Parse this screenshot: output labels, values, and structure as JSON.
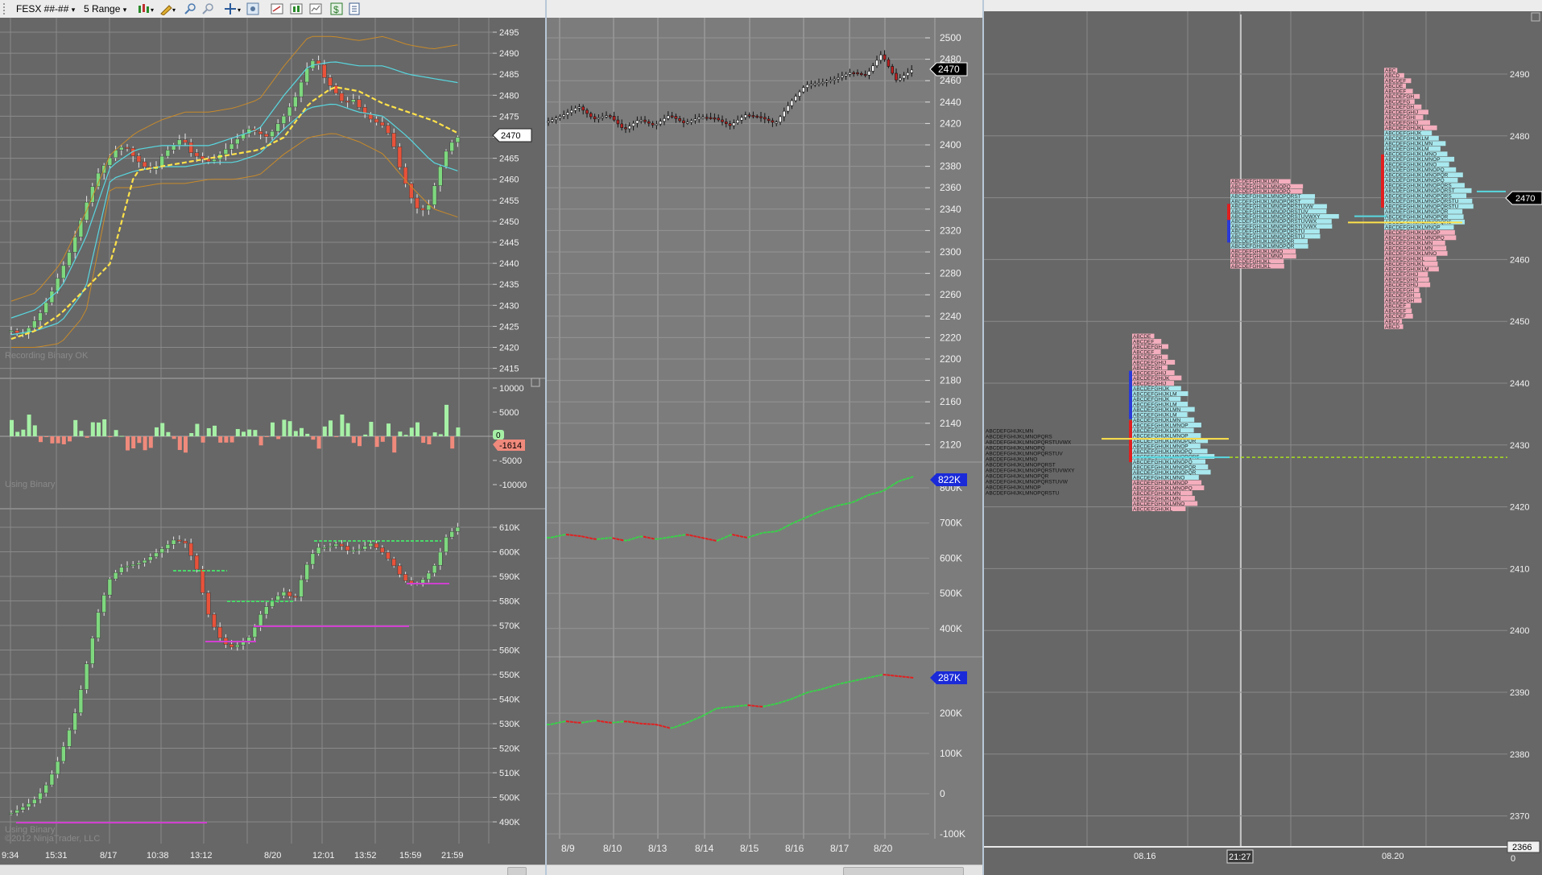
{
  "toolbar": {
    "instrument": "FESX ##-##",
    "bar_type": "5 Range",
    "chevron": "▾"
  },
  "colors": {
    "panel": "#676767",
    "panel_mid": "#7c7c7c",
    "grid": "#8a8a8a",
    "up": "#7ed87e",
    "down": "#e8523a",
    "volup": "#a6f0a6",
    "voldn": "#f08a7c",
    "yellow": "#ffe24a",
    "cyan": "#58d8e0",
    "orange": "#c88a2a",
    "magenta": "#d040d0",
    "tpo_pink": "#f4aebd",
    "tpo_cyan": "#a8e8ee",
    "axis_text": "#f2f2f2"
  },
  "left": {
    "price": {
      "ticks": [
        "2495",
        "2490",
        "2485",
        "2480",
        "2475",
        "2470",
        "2465",
        "2460",
        "2455",
        "2450",
        "2445",
        "2440",
        "2435",
        "2430",
        "2425",
        "2420",
        "2415"
      ],
      "last": "2470",
      "watermark": "Recording Binary OK"
    },
    "delta": {
      "ticks": [
        "10000",
        "5000",
        "0",
        "-5000",
        "-10000"
      ],
      "last": "-1614",
      "zero_tag": "0",
      "watermark": "Using Binary"
    },
    "cum": {
      "ticks": [
        "610K",
        "600K",
        "590K",
        "580K",
        "570K",
        "560K",
        "550K",
        "540K",
        "530K",
        "520K",
        "510K",
        "500K",
        "490K"
      ],
      "watermark1": "Using Binary",
      "watermark2": "©2012 NinjaTrader, LLC"
    },
    "xaxis": [
      "9:34",
      "15:31",
      "8/17",
      "10:38",
      "13:12",
      "8/20",
      "12:01",
      "13:52",
      "15:59",
      "21:59"
    ]
  },
  "mid": {
    "price": {
      "ticks": [
        "2500",
        "2480",
        "2460",
        "2440",
        "2420",
        "2400",
        "2380",
        "2360",
        "2340",
        "2320",
        "2300",
        "2280",
        "2260",
        "2240",
        "2220",
        "2200",
        "2180",
        "2160",
        "2140",
        "2120"
      ],
      "last": "2470"
    },
    "vol1": {
      "ticks": [
        "800K",
        "700K",
        "600K",
        "500K",
        "400K"
      ],
      "last": "822K"
    },
    "vol2": {
      "ticks": [
        "200K",
        "100K",
        "0",
        "-100K"
      ],
      "last": "287K"
    },
    "xaxis": [
      "8/9",
      "8/10",
      "8/13",
      "8/14",
      "8/15",
      "8/16",
      "8/17",
      "8/20"
    ]
  },
  "right": {
    "ticks": [
      "2490",
      "2480",
      "2470",
      "2460",
      "2450",
      "2440",
      "2430",
      "2420",
      "2410",
      "2400",
      "2390",
      "2380",
      "2370"
    ],
    "last": "2470",
    "corner": "2366",
    "zero": "0",
    "xlabels": [
      "08.16",
      "21:27",
      "08.20"
    ],
    "letters": "ABCDEFGHIJKLMNOPQRSTUVWXYZabcdef"
  }
}
